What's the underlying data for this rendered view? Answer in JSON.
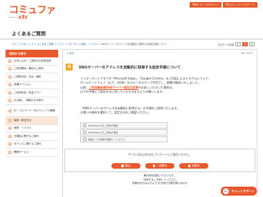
{
  "header": {
    "logo_main": "コミュファ",
    "logo_sub": "Powered by",
    "logo_ctc": "ctc",
    "top_links": [
      "Web メールログイン",
      "Myコミュファログイン"
    ]
  },
  "page_title": "よくあるご質問",
  "breadcrumb": {
    "links": [
      "コミュファ光 トップ",
      "よくあるご質問 トップ",
      "インターネット接続・トラブル"
    ],
    "current": "DNSサーバーのアドレスを自動的に取得する設定手順について"
  },
  "font_size": {
    "label": "文字サイズ変更",
    "small": "小",
    "medium": "中",
    "large": "大"
  },
  "sidebar": {
    "heading": "目的から探す",
    "items": [
      {
        "icon": "●",
        "label": "お申し込み・ご契約中の変更全般"
      },
      {
        "icon": "●",
        "label": "ご利用開始・解約のご案内"
      },
      {
        "icon": "●",
        "label": "ご請求内容・支払・解約"
      },
      {
        "icon": "●",
        "label": "各種オプション"
      },
      {
        "icon": "●",
        "label": "ご利用料金・料金プラン"
      },
      {
        "icon": "●",
        "label": "お引越し・移転のお手続き"
      },
      {
        "icon": "●",
        "label": "ID・パスワード・Myコミュファ関連"
      },
      {
        "icon": "●",
        "label": "接続・設定方法"
      },
      {
        "icon": "●",
        "label": "故障・トラブル"
      },
      {
        "icon": "●",
        "label": "光電話に関するご案内"
      },
      {
        "icon": "●",
        "label": "光テレビに関するご案内"
      },
      {
        "icon": "●",
        "label": "関連サービス"
      }
    ]
  },
  "main": {
    "back_label": "< 戻る",
    "faq_no": "No : 3722",
    "q_badge": "Q",
    "title": "DNSサーバーのアドレスを自動的に取得する設定手順について",
    "para1_line1": "インターネットブラウザ「Microsoft Edge」、「Google Chrome」のご利用によるトラブルについて、",
    "para1_line2": "ホームゲートウェイ（以下、HGW）のステータスアップが完了し、問題が解消いたしました。",
    "para1_line3_pre": "以前、",
    "para1_link": "ご利用端末側DNSサーバー設定の変更",
    "para1_line3_post": "をお試しいただいた場合は、",
    "para1_line4": "以下の手順にて設定を元に戻していただきますようお願いします。",
    "para2_line1": "「DNSサーバーのアドレスを自動的に取得する」の手順をご説明いたします。",
    "para2_line2": "お使いの端末を選択して、設定方法をご確認ください。",
    "choices": [
      "Windows10をご利用の場合",
      "Windows11をご利用の場合",
      "製品につき構成を選択してください"
    ],
    "survey_question": "サービス向上のためにアンケートにご協力ください。",
    "survey_buttons": [
      "解決",
      "一部解決",
      "未解決"
    ],
    "thanks_lines": [
      "解決済を回答いただいた方、",
      "「送信する」を押してください。",
      "未解決の方は以下より 引き続き日遭お問い合わせ"
    ]
  },
  "chatbot": {
    "label": "チャットサポート",
    "icon": "💬"
  },
  "colors": {
    "brand": "#e8582a",
    "link": "#3a6ab3",
    "badge": "#f5a623"
  }
}
